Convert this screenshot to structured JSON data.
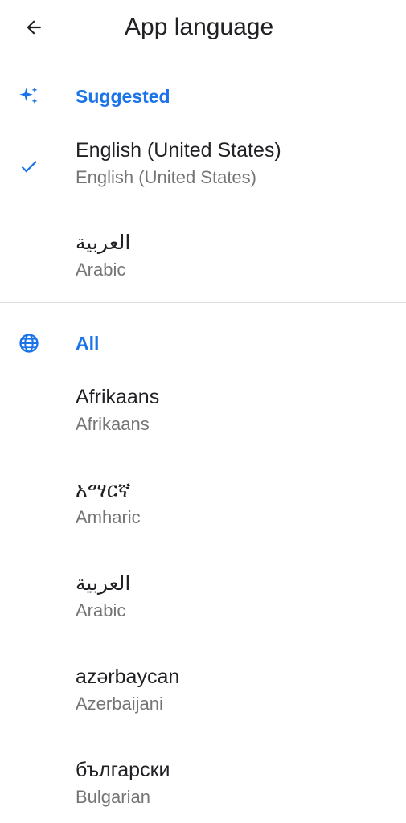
{
  "header": {
    "title": "App language",
    "back_icon": "arrow-back-icon"
  },
  "accent_color": "#1a73e8",
  "suggested": {
    "label": "Suggested",
    "icon": "sparkle-icon",
    "items": [
      {
        "native": "English (United States)",
        "english": "English (United States)",
        "selected": true
      },
      {
        "native": "العربية",
        "english": "Arabic",
        "selected": false
      }
    ]
  },
  "all": {
    "label": "All",
    "icon": "globe-icon",
    "items": [
      {
        "native": "Afrikaans",
        "english": "Afrikaans"
      },
      {
        "native": "አማርኛ",
        "english": "Amharic"
      },
      {
        "native": "العربية",
        "english": "Arabic"
      },
      {
        "native": "azərbaycan",
        "english": "Azerbaijani"
      },
      {
        "native": "български",
        "english": "Bulgarian"
      }
    ]
  }
}
